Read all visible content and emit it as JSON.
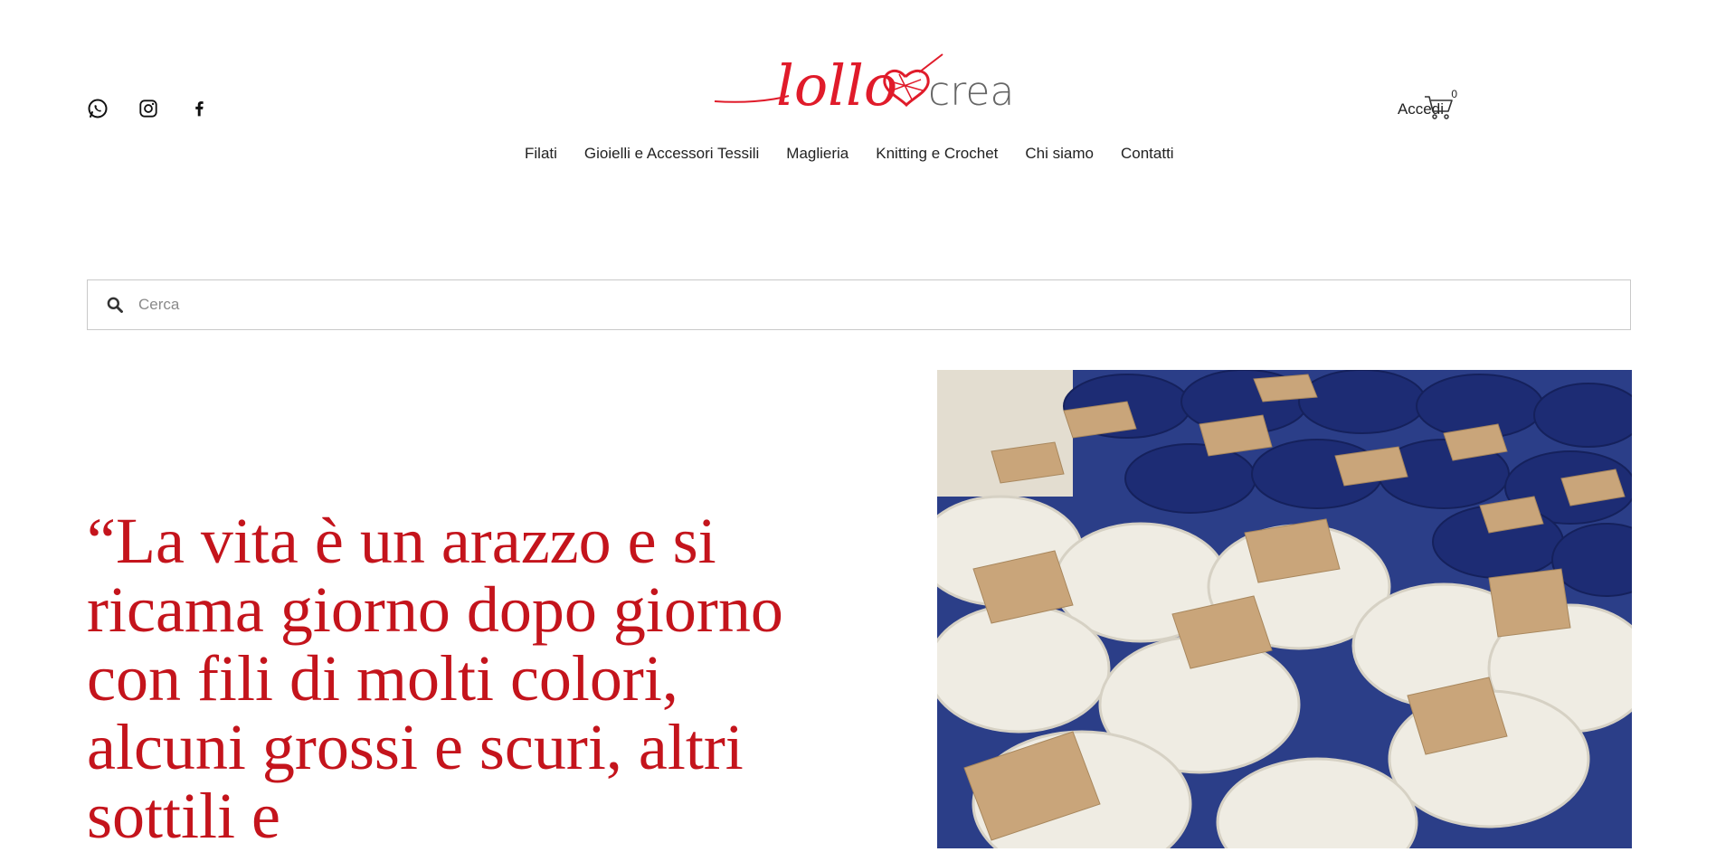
{
  "header": {
    "social": [
      {
        "name": "whatsapp-icon"
      },
      {
        "name": "instagram-icon"
      },
      {
        "name": "facebook-icon"
      }
    ],
    "logo_text": {
      "part1": "lollo",
      "part2": "crea"
    },
    "account_label": "Accedi",
    "cart_count": "0"
  },
  "nav": {
    "items": [
      "Filati",
      "Gioielli e Accessori Tessili",
      "Maglieria",
      "Knitting e Crochet",
      "Chi siamo",
      "Contatti"
    ]
  },
  "search": {
    "placeholder": "Cerca"
  },
  "hero": {
    "quote": "“La vita è un arazzo e si ricama giorno dopo giorno con fili di molti colori, alcuni grossi e scuri, altri sottili e"
  },
  "colors": {
    "accent": "#c4141c",
    "yarn_blue": "#1f2f7a",
    "yarn_white": "#efece3",
    "tag": "#c9a57a"
  }
}
